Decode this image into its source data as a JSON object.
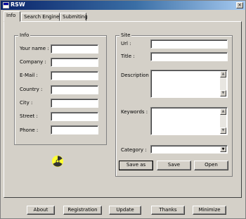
{
  "window": {
    "title": "RSW"
  },
  "tabs": [
    {
      "label": "Info",
      "active": true
    },
    {
      "label": "Search Engines",
      "active": false
    },
    {
      "label": "Submiting",
      "active": false
    }
  ],
  "info_group": {
    "legend": "Info",
    "fields": [
      {
        "label": "Your name :",
        "value": ""
      },
      {
        "label": "Company :",
        "value": ""
      },
      {
        "label": "E-Mail :",
        "value": ""
      },
      {
        "label": "Country :",
        "value": ""
      },
      {
        "label": "City :",
        "value": ""
      },
      {
        "label": "Street :",
        "value": ""
      },
      {
        "label": "Phone :",
        "value": ""
      }
    ]
  },
  "site_group": {
    "legend": "Site",
    "url_label": "Url :",
    "url_value": "",
    "title_label": "Title :",
    "title_value": "",
    "description_label": "Description :",
    "description_value": "",
    "keywords_label": "Keywords :",
    "keywords_value": "",
    "category_label": "Category :",
    "category_value": ""
  },
  "site_buttons": {
    "save_as": "Save as",
    "save": "Save",
    "open": "Open"
  },
  "bottom_buttons": [
    "About",
    "Registration",
    "Update",
    "Thanks",
    "Minimize"
  ],
  "colors": {
    "face": "#d4d0c8",
    "title_start": "#0a246a",
    "title_end": "#a6caf0",
    "icon_yellow": "#ffff33"
  },
  "icons": {
    "app": "rsw-app-icon",
    "status": "radiation-icon"
  }
}
